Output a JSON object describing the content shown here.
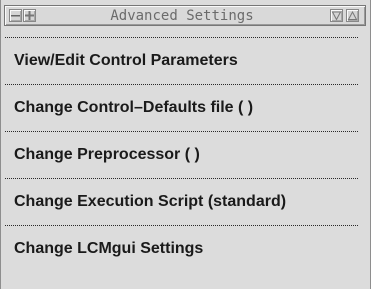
{
  "window": {
    "title": "Advanced Settings",
    "buttons": {
      "menu_icon": "window-menu-icon",
      "pin_icon": "pin-icon",
      "minimize_icon": "minimize-triangle-icon",
      "maximize_icon": "maximize-triangle-icon"
    }
  },
  "menu": {
    "items": [
      {
        "label": "View/Edit Control Parameters"
      },
      {
        "label": "Change Control–Defaults file  ( )"
      },
      {
        "label": "Change Preprocessor  ( )"
      },
      {
        "label": "Change Execution Script  (standard)"
      },
      {
        "label": "Change LCMgui Settings"
      }
    ]
  },
  "colors": {
    "background": "#dcdcdc",
    "title_text": "#6b6b6b",
    "item_text": "#1a1a1a",
    "separator": "#2a2a2a"
  }
}
